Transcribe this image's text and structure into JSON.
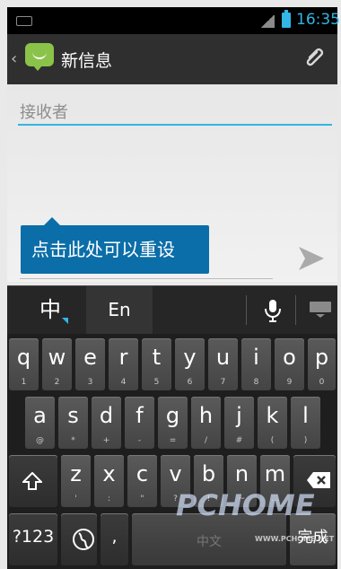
{
  "status_bar": {
    "time": "16:35"
  },
  "action_bar": {
    "title": "新信息"
  },
  "compose": {
    "recipient_placeholder": "接收者"
  },
  "tooltip": {
    "text": "点击此处可以重设"
  },
  "keyboard": {
    "top_chinese": "中",
    "top_english": "En",
    "keys": {
      "q": "q",
      "w": "w",
      "e": "e",
      "r": "r",
      "t": "t",
      "y": "y",
      "u": "u",
      "i": "i",
      "o": "o",
      "p": "p",
      "a": "a",
      "s": "s",
      "d": "d",
      "f": "f",
      "g": "g",
      "h": "h",
      "j": "j",
      "k": "k",
      "l": "l",
      "z": "z",
      "x": "x",
      "c": "c",
      "v": "v",
      "b": "b",
      "n": "n",
      "m": "m"
    },
    "subs": {
      "q": "1",
      "w": "2",
      "e": "3",
      "r": "4",
      "t": "5",
      "y": "6",
      "u": "7",
      "i": "8",
      "o": "9",
      "p": "0",
      "a": "@",
      "s": "*",
      "d": "+",
      "f": "-",
      "g": "=",
      "h": "/",
      "j": "#",
      "k": "(",
      "l": ")",
      "z": "'",
      "x": ":",
      "c": "\"",
      "v": "?",
      "b": "!",
      "n": "~",
      "m": "…"
    },
    "numbers_label": "?123",
    "comma_label": ",",
    "space_label": "中文",
    "done_label": "完成"
  },
  "watermark": {
    "brand": "PCHOME",
    "site": "WWW.PCHOME.NET"
  }
}
